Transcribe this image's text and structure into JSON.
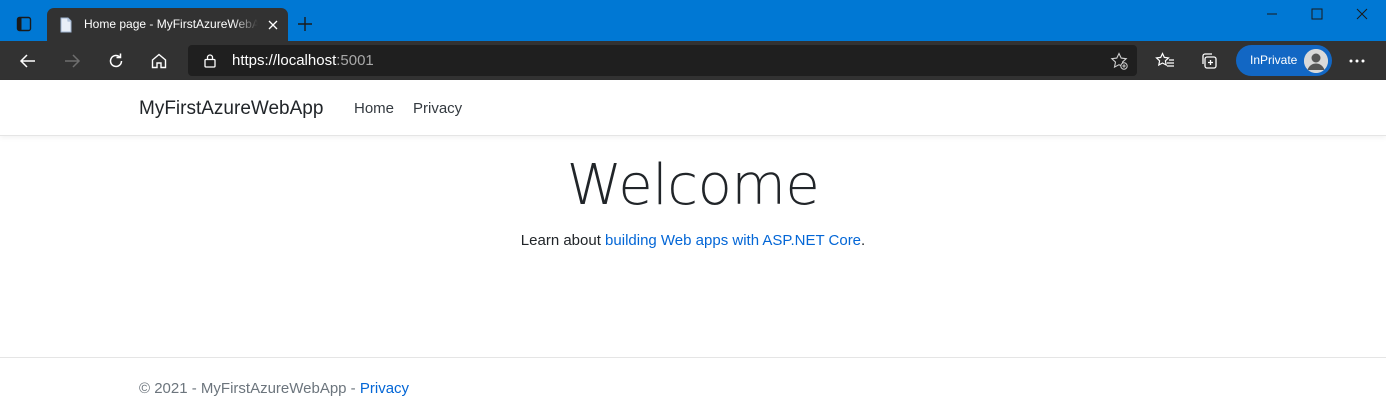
{
  "browser": {
    "tab": {
      "title": "Home page - MyFirstAzureWebApp"
    },
    "address": {
      "scheme": "https://",
      "host": "localhost",
      "port": ":5001"
    },
    "inprivate_label": "InPrivate",
    "icons": [
      "tab-actions-icon",
      "page-favicon",
      "close-icon",
      "plus-icon",
      "minimize-icon",
      "maximize-icon",
      "close-window-icon",
      "back-arrow-icon",
      "forward-arrow-icon",
      "refresh-icon",
      "home-icon",
      "lock-icon",
      "star-add-icon",
      "favorites-icon",
      "collections-icon",
      "avatar",
      "more-icon"
    ],
    "colors": {
      "titlebar": "#0078d4",
      "toolbar": "#323232",
      "omnibox": "#1f1f1f",
      "inprivate": "#1267c4"
    }
  },
  "page": {
    "navbar": {
      "brand": "MyFirstAzureWebApp",
      "links": [
        "Home",
        "Privacy"
      ]
    },
    "main": {
      "heading": "Welcome",
      "intro_prefix": "Learn about ",
      "intro_link": "building Web apps with ASP.NET Core",
      "intro_suffix": "."
    },
    "footer": {
      "copyright": "© 2021 - MyFirstAzureWebApp - ",
      "privacy_link": "Privacy"
    },
    "colors": {
      "link": "#0366d6",
      "muted": "#6c757d"
    }
  }
}
